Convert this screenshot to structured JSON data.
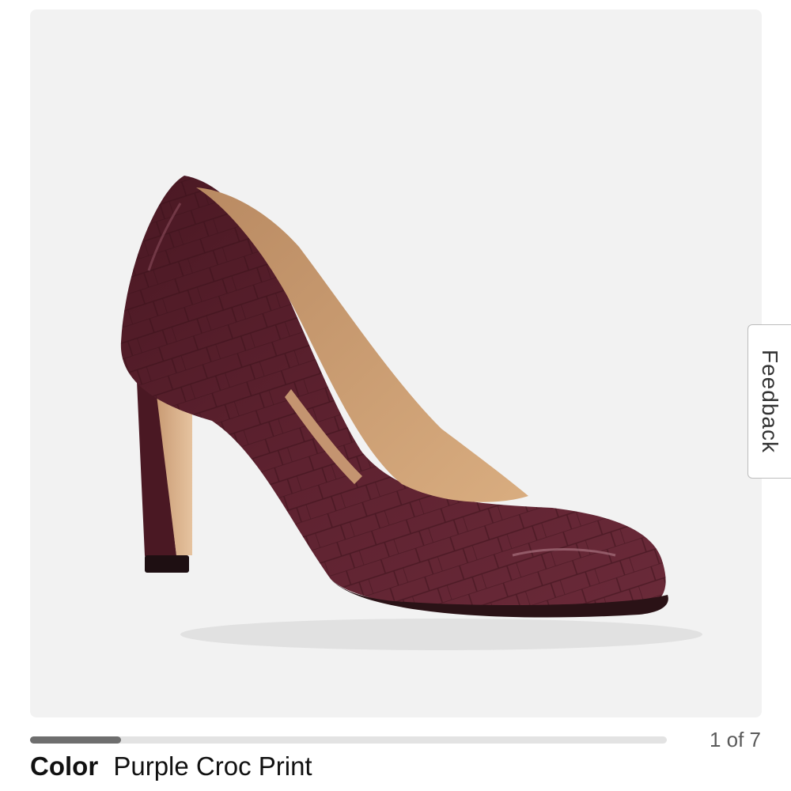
{
  "product_image": {
    "alt": "Purple croc print high heel pump",
    "icon": "shoe-photo"
  },
  "feedback_tab": {
    "label": "Feedback"
  },
  "carousel": {
    "current": 1,
    "total": 7,
    "counter_text": "1 of 7",
    "progress_fraction": 0.1429
  },
  "color": {
    "label": "Color",
    "value": "Purple Croc Print"
  },
  "colors": {
    "image_background": "#f2f2f2",
    "progress_fill": "#6e6e6e",
    "progress_track": "#e3e3e3",
    "shoe": "#5a1f2c"
  }
}
